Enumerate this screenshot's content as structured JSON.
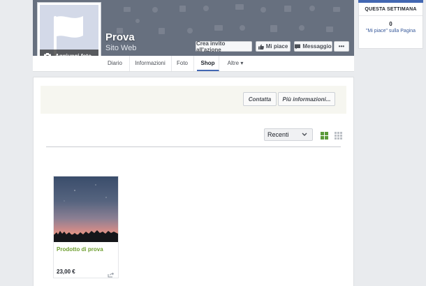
{
  "page": {
    "name": "Prova",
    "category": "Sito Web",
    "add_photo_label": "Aggiungi foto"
  },
  "actions": {
    "create_cta": "Crea invito all'azione",
    "like": "Mi piace",
    "message": "Messaggio",
    "more": "•••"
  },
  "tabs": [
    {
      "label": "Diario"
    },
    {
      "label": "Informazioni"
    },
    {
      "label": "Foto"
    },
    {
      "label": "Shop",
      "active": true
    },
    {
      "label": "Altre ▾"
    }
  ],
  "sidebar": {
    "heading": "QUESTA SETTIMANA",
    "count": "0",
    "likes_text": "\"Mi piace\" sulla Pagina"
  },
  "shop": {
    "contact_label": "Contatta",
    "more_info_label": "Più informazioni...",
    "sort_value": "Recenti",
    "products": [
      {
        "name": "Prodotto di prova",
        "price": "23,00 €"
      }
    ]
  },
  "colors": {
    "accent": "#4267b2",
    "product_name": "#6e9e30",
    "cover": "#67707f"
  }
}
